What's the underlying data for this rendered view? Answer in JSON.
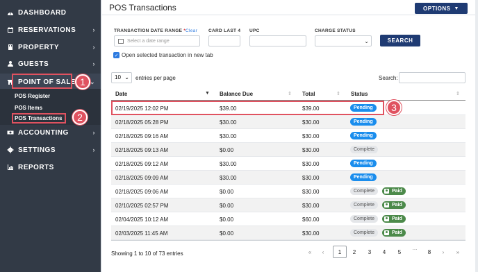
{
  "sidebar": {
    "items": [
      {
        "label": "DASHBOARD",
        "icon": "dashboard-icon"
      },
      {
        "label": "RESERVATIONS",
        "icon": "calendar-icon"
      },
      {
        "label": "PROPERTY",
        "icon": "building-icon"
      },
      {
        "label": "GUESTS",
        "icon": "user-icon"
      },
      {
        "label": "POINT OF SALE",
        "icon": "store-icon"
      },
      {
        "label": "ACCOUNTING",
        "icon": "money-icon"
      },
      {
        "label": "SETTINGS",
        "icon": "gear-icon"
      },
      {
        "label": "REPORTS",
        "icon": "chart-icon"
      }
    ],
    "subitems": [
      "POS Register",
      "POS Items",
      "POS Transactions"
    ]
  },
  "callouts": [
    "1",
    "2",
    "3"
  ],
  "header": {
    "title": "POS Transactions",
    "options_label": "OPTIONS"
  },
  "filters": {
    "date_range_label": "TRANSACTION DATE RANGE",
    "required_mark": "*",
    "clear_label": "Clear",
    "date_placeholder": "Select a date range",
    "card_label": "CARD LAST 4",
    "upc_label": "UPC",
    "charge_status_label": "CHARGE STATUS",
    "search_button": "SEARCH",
    "open_new_tab_label": "Open selected transaction in new tab"
  },
  "table_controls": {
    "page_length": "10",
    "entries_label": "entries per page",
    "search_label": "Search:"
  },
  "columns": [
    "Date",
    "Balance Due",
    "Total",
    "Status"
  ],
  "rows": [
    {
      "date": "02/19/2025 12:02 PM",
      "balance": "$39.00",
      "total": "$39.00",
      "status": "Pending",
      "paid": ""
    },
    {
      "date": "02/18/2025 05:28 PM",
      "balance": "$30.00",
      "total": "$30.00",
      "status": "Pending",
      "paid": ""
    },
    {
      "date": "02/18/2025 09:16 AM",
      "balance": "$30.00",
      "total": "$30.00",
      "status": "Pending",
      "paid": ""
    },
    {
      "date": "02/18/2025 09:13 AM",
      "balance": "$0.00",
      "total": "$30.00",
      "status": "Complete",
      "paid": ""
    },
    {
      "date": "02/18/2025 09:12 AM",
      "balance": "$30.00",
      "total": "$30.00",
      "status": "Pending",
      "paid": ""
    },
    {
      "date": "02/18/2025 09:09 AM",
      "balance": "$30.00",
      "total": "$30.00",
      "status": "Pending",
      "paid": ""
    },
    {
      "date": "02/18/2025 09:06 AM",
      "balance": "$0.00",
      "total": "$30.00",
      "status": "Complete",
      "paid": "Paid"
    },
    {
      "date": "02/10/2025 02:57 PM",
      "balance": "$0.00",
      "total": "$30.00",
      "status": "Complete",
      "paid": "Paid"
    },
    {
      "date": "02/04/2025 10:12 AM",
      "balance": "$0.00",
      "total": "$60.00",
      "status": "Complete",
      "paid": "Paid"
    },
    {
      "date": "02/03/2025 11:45 AM",
      "balance": "$0.00",
      "total": "$30.00",
      "status": "Complete",
      "paid": "Paid"
    }
  ],
  "footer": {
    "showing": "Showing 1 to 10 of 73 entries",
    "pages": [
      "«",
      "‹",
      "1",
      "2",
      "3",
      "4",
      "5",
      "...",
      "8",
      "›",
      "»"
    ],
    "current_page": "1"
  },
  "colors": {
    "accent": "#1f3b73",
    "pending": "#1a8ded",
    "paid": "#4c8a4a",
    "highlight": "#e05260",
    "sidebar": "#323a46"
  }
}
